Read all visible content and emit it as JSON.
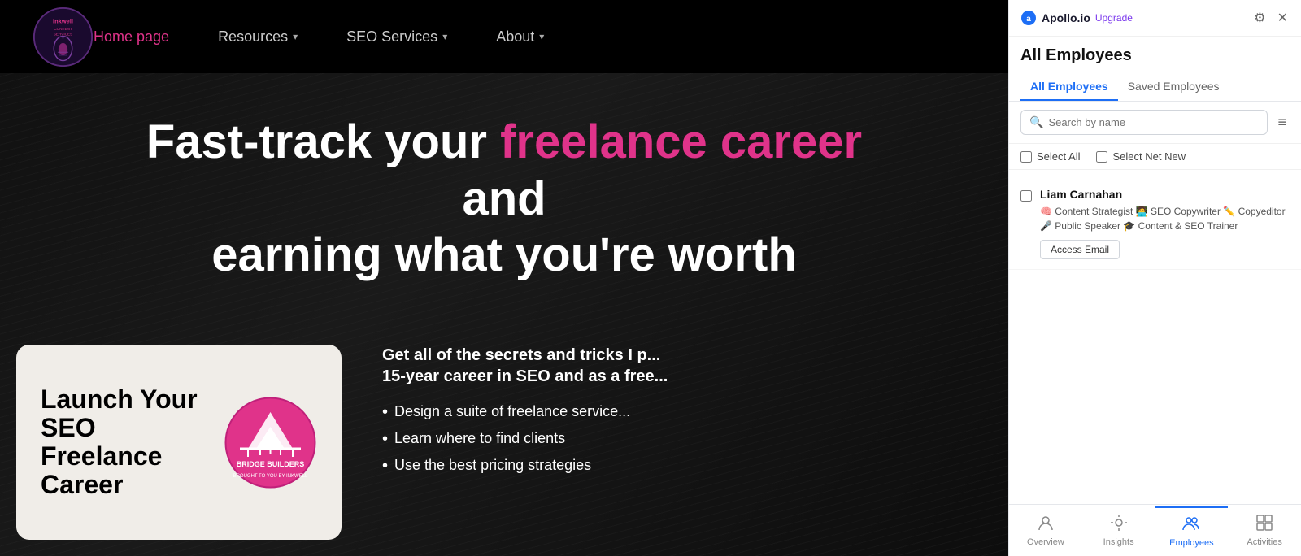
{
  "website": {
    "nav": {
      "logo_alt": "Inkwell Content Services",
      "home_label": "Home page",
      "resources_label": "Resources",
      "seo_services_label": "SEO Services",
      "about_label": "About"
    },
    "hero": {
      "title_part1": "Fast-track your ",
      "title_highlight": "freelance career",
      "title_part2": " and",
      "title_line2": "earning what you're worth",
      "subtitle": "Get all of the secrets and tricks I p... 15-year career in SEO and as a free...",
      "bullets": [
        "Design a suite of freelance service...",
        "Learn where to find clients",
        "Use the best pricing strategies"
      ]
    },
    "launch_card": {
      "line1": "Launch Your SEO",
      "line2": "Freelance Career",
      "badge_text": "BRIDGE BUILDERS",
      "badge_sub": "BROUGHT TO YOU BY INKWELL"
    }
  },
  "apollo": {
    "brand": "Apollo.io",
    "upgrade_label": "Upgrade",
    "panel_title": "All Employees",
    "tabs": [
      {
        "id": "all",
        "label": "All Employees",
        "active": true
      },
      {
        "id": "saved",
        "label": "Saved Employees",
        "active": false
      }
    ],
    "search_placeholder": "Search by name",
    "filter_icon": "≡",
    "select_all_label": "Select All",
    "select_net_new_label": "Select Net New",
    "employees": [
      {
        "name": "Liam Carnahan",
        "roles": "🧠 Content Strategist 🧑‍💻 SEO Copywriter ✏️ Copyeditor 🎤 Public Speaker 🎓 Content & SEO Trainer",
        "access_email_label": "Access Email"
      }
    ],
    "bottom_nav": [
      {
        "id": "overview",
        "label": "Overview",
        "icon": "👤",
        "active": false
      },
      {
        "id": "insights",
        "label": "Insights",
        "icon": "💡",
        "active": false
      },
      {
        "id": "employees",
        "label": "Employees",
        "icon": "👥",
        "active": true
      },
      {
        "id": "activities",
        "label": "Activities",
        "icon": "⊞",
        "active": false
      }
    ]
  }
}
